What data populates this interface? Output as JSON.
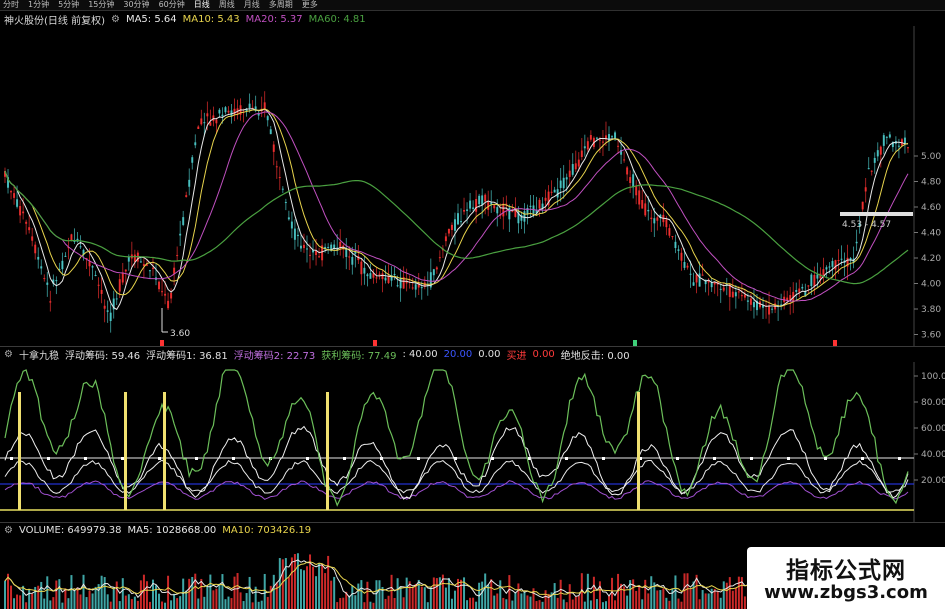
{
  "toolbar": {
    "tabs": [
      "分时",
      "1分钟",
      "5分钟",
      "15分钟",
      "30分钟",
      "60分钟",
      "日线",
      "周线",
      "月线",
      "多周期",
      "更多"
    ],
    "active": "日线"
  },
  "price_panel": {
    "stock_title": "神火股份(日线 前复权)",
    "ma5_label": "MA5: 5.64",
    "ma10_label": "MA10: 5.43",
    "ma20_label": "MA20: 5.37",
    "ma60_label": "MA60: 4.81",
    "low_marker": "3.60",
    "band_label": "4.53 - 4.57",
    "y_axis": [
      "5.00",
      "4.80",
      "4.60",
      "4.40",
      "4.20",
      "4.00",
      "3.80",
      "3.60"
    ]
  },
  "indicator_panel": {
    "name": "十拿九稳",
    "items": [
      {
        "text": "浮动筹码: 59.46",
        "color": "#e0e0e0"
      },
      {
        "text": "浮动筹码1: 36.81",
        "color": "#e0e0e0"
      },
      {
        "text": "浮动筹码2: 22.73",
        "color": "#c070e0"
      },
      {
        "text": "获利筹码: 77.49",
        "color": "#6cbf5a"
      },
      {
        "text": ": 40.00",
        "color": "#e0e0e0"
      },
      {
        "text": "20.00",
        "color": "#3a55ff"
      },
      {
        "text": "0.00",
        "color": "#e0e0e0"
      },
      {
        "text": "买进",
        "color": "#ff3b3b"
      },
      {
        "text": "0.00",
        "color": "#ff3b3b"
      },
      {
        "text": "绝地反击: 0.00",
        "color": "#e0e0e0"
      }
    ],
    "y_axis": [
      "100.0",
      "80.00",
      "60.00",
      "40.00",
      "20.00"
    ]
  },
  "volume_panel": {
    "volume_label": "VOLUME: 649979.38",
    "ma5_label": "MA5: 1028668.00",
    "ma10_label": "MA10: 703426.19"
  },
  "watermark": {
    "line1": "指标公式网",
    "line2": "www.zbgs3.com"
  },
  "colors": {
    "ma5": "#e8e8e8",
    "ma10": "#e8d44d",
    "ma20": "#c050c0",
    "ma60": "#4aa040",
    "up": "#ff3333",
    "down": "#4fd0d0"
  }
}
